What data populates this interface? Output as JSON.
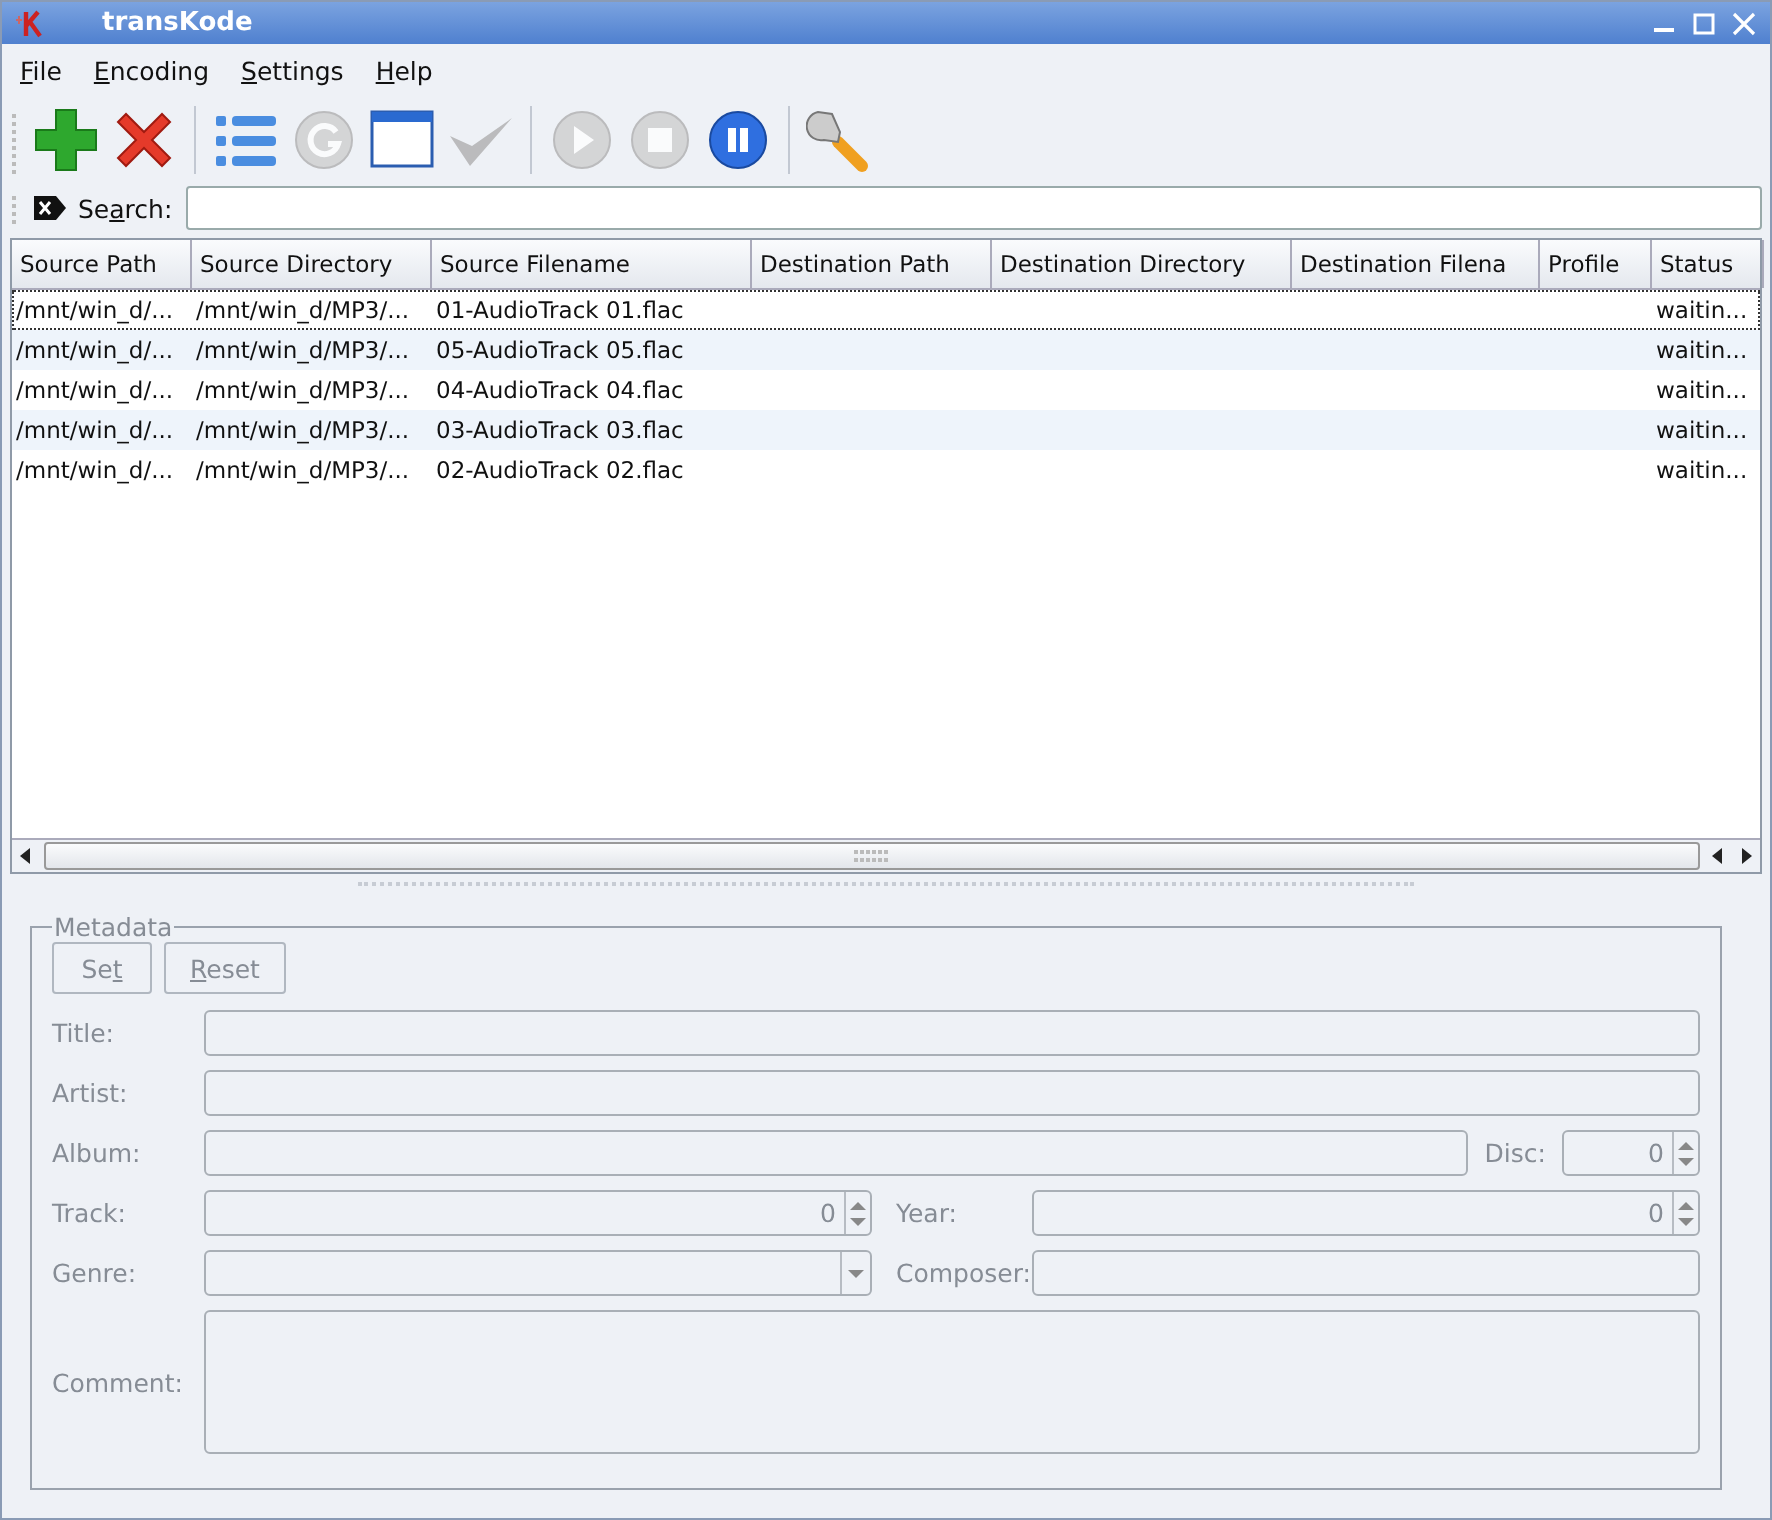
{
  "window": {
    "title": "transKode"
  },
  "menu": [
    {
      "label": "File"
    },
    {
      "label": "Encoding"
    },
    {
      "label": "Settings"
    },
    {
      "label": "Help"
    }
  ],
  "toolbar": [
    {
      "kind": "plus",
      "disabled": false
    },
    {
      "kind": "cross",
      "disabled": false
    },
    {
      "kind": "separator"
    },
    {
      "kind": "list",
      "disabled": false
    },
    {
      "kind": "refresh",
      "disabled": true
    },
    {
      "kind": "window",
      "disabled": false
    },
    {
      "kind": "check",
      "disabled": true
    },
    {
      "kind": "separator"
    },
    {
      "kind": "play",
      "disabled": true
    },
    {
      "kind": "stop",
      "disabled": true
    },
    {
      "kind": "pause",
      "disabled": false
    },
    {
      "kind": "separator"
    },
    {
      "kind": "wrench",
      "disabled": false
    }
  ],
  "search": {
    "label": "Search:"
  },
  "table": {
    "columns": [
      "Source Path",
      "Source Directory",
      "Source Filename",
      "Destination Path",
      "Destination Directory",
      "Destination Filena",
      "Profile",
      "Status"
    ],
    "rows": [
      {
        "focused": true,
        "cells": [
          "/mnt/win_d/...",
          "/mnt/win_d/MP3/...",
          "01-AudioTrack 01.flac",
          "",
          "",
          "",
          "",
          "waitin..."
        ]
      },
      {
        "focused": false,
        "cells": [
          "/mnt/win_d/...",
          "/mnt/win_d/MP3/...",
          "05-AudioTrack 05.flac",
          "",
          "",
          "",
          "",
          "waitin..."
        ]
      },
      {
        "focused": false,
        "cells": [
          "/mnt/win_d/...",
          "/mnt/win_d/MP3/...",
          "04-AudioTrack 04.flac",
          "",
          "",
          "",
          "",
          "waitin..."
        ]
      },
      {
        "focused": false,
        "cells": [
          "/mnt/win_d/...",
          "/mnt/win_d/MP3/...",
          "03-AudioTrack 03.flac",
          "",
          "",
          "",
          "",
          "waitin..."
        ]
      },
      {
        "focused": false,
        "cells": [
          "/mnt/win_d/...",
          "/mnt/win_d/MP3/...",
          "02-AudioTrack 02.flac",
          "",
          "",
          "",
          "",
          "waitin..."
        ]
      }
    ]
  },
  "metadata": {
    "title": "Metadata",
    "disabled": true,
    "buttons": [
      {
        "label": "Set"
      },
      {
        "label": "Reset"
      }
    ],
    "labels": {
      "title": "Title:",
      "artist": "Artist:",
      "album": "Album:",
      "disc": "Disc:",
      "track": "Track:",
      "year": "Year:",
      "genre": "Genre:",
      "composer": "Composer:",
      "comment": "Comment:"
    },
    "disc": "0",
    "track": "0",
    "year": "0"
  }
}
